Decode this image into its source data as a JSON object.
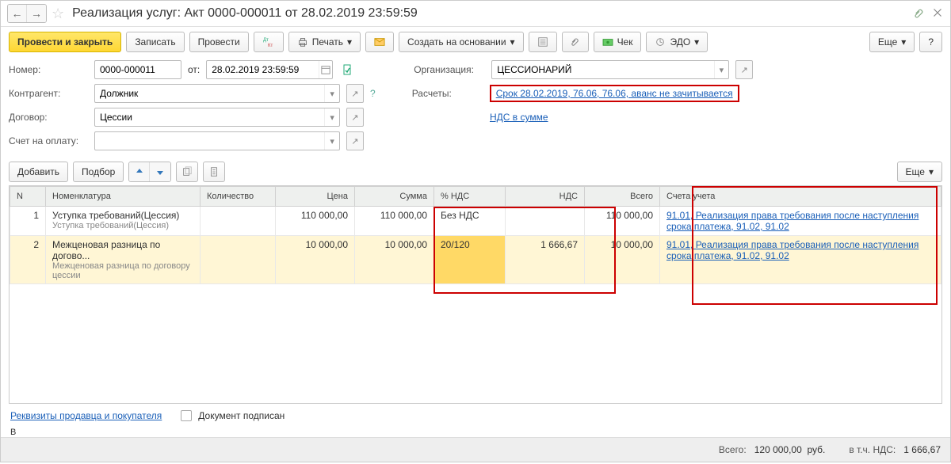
{
  "titlebar": {
    "title": "Реализация услуг: Акт 0000-000011 от 28.02.2019 23:59:59"
  },
  "toolbar": {
    "post_close": "Провести и закрыть",
    "save": "Записать",
    "post": "Провести",
    "print": "Печать",
    "create_based": "Создать на основании",
    "check": "Чек",
    "edo": "ЭДО",
    "more": "Еще",
    "help": "?"
  },
  "form": {
    "number_label": "Номер:",
    "number": "0000-000011",
    "from_label": "от:",
    "date": "28.02.2019 23:59:59",
    "org_label": "Организация:",
    "org": "ЦЕССИОНАРИЙ",
    "counterparty_label": "Контрагент:",
    "counterparty": "Должник",
    "calc_label": "Расчеты:",
    "calc_link": "Срок 28.02.2019, 76.06, 76.06, аванс не зачитывается",
    "contract_label": "Договор:",
    "contract": "Цессии",
    "vat_link": "НДС в сумме",
    "invoice_label": "Счет на оплату:"
  },
  "section": {
    "add": "Добавить",
    "pick": "Подбор",
    "more": "Еще"
  },
  "table": {
    "headers": {
      "n": "N",
      "nom": "Номенклатура",
      "qty": "Количество",
      "price": "Цена",
      "sum": "Сумма",
      "vat_pct": "% НДС",
      "vat": "НДС",
      "total": "Всего",
      "accounts": "Счета учета"
    },
    "rows": [
      {
        "n": "1",
        "nom": "Уступка требований(Цессия)",
        "nom_sub": "Уступка требований(Цессия)",
        "qty": "",
        "price": "110 000,00",
        "sum": "110 000,00",
        "vat_pct": "Без НДС",
        "vat": "",
        "total": "110 000,00",
        "acct": "91.01, Реализация права требования после наступления срока платежа, 91.02, 91.02"
      },
      {
        "n": "2",
        "nom": "Межценовая разница по догово...",
        "nom_sub": "Межценовая разница по договору цессии",
        "qty": "",
        "price": "10 000,00",
        "sum": "10 000,00",
        "vat_pct": "20/120",
        "vat": "1 666,67",
        "total": "10 000,00",
        "acct": "91.01, Реализация права требования после наступления срока платежа, 91.02, 91.02"
      }
    ]
  },
  "footer": {
    "requisites": "Реквизиты продавца и покупателя",
    "signed": "Документ подписан",
    "stray": "В"
  },
  "totals": {
    "total_label": "Всего:",
    "total": "120 000,00",
    "currency": "руб.",
    "vat_label": "в т.ч. НДС:",
    "vat": "1 666,67"
  }
}
